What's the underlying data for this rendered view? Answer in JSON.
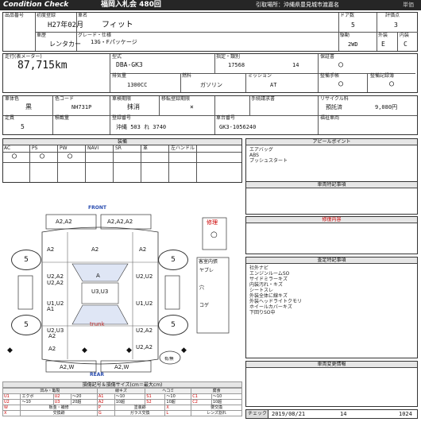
{
  "header": {
    "brand": "Condition Check",
    "auction": "福岡入札会 480回",
    "pickup": "引取場所：沖縄県豊見城市渡嘉名",
    "tail": "単価"
  },
  "top": {
    "lot_label": "出品番号",
    "first_reg_label": "初度登録",
    "first_reg": "H27年02月",
    "name_label": "車名",
    "name": "フィット",
    "doors_label": "ドア数",
    "doors": "5",
    "score_label": "評価点",
    "score": "3",
    "history_label": "車歴",
    "history": "レンタカー",
    "grade_label": "グレード・仕様",
    "grade": "13G・Fパッケージ",
    "drive_label": "駆動",
    "drive": "2WD",
    "ext_label": "外装",
    "ext": "E",
    "int_label": "内装",
    "int": "C"
  },
  "mid": {
    "mileage_label": "走行(表メーター)",
    "mileage": "87,715km",
    "model_label": "型式",
    "model": "DBA-GK3",
    "designation_label": "指定・類別",
    "designation": "17568",
    "category": "14",
    "warranty_label": "保証書",
    "warranty": "○",
    "disp_label": "排気量",
    "disp": "1300CC",
    "fuel_label": "燃料",
    "fuel": "ガソリン",
    "mission_label": "ミッション",
    "mission": "AT",
    "manual_label": "整備手帳",
    "manual": "○",
    "record_label": "整備記録簿",
    "record": "○"
  },
  "body": {
    "color_label": "車体色",
    "color": "黒",
    "code_label": "色コード",
    "code": "NH731P",
    "inspection_label": "車検期限",
    "inspection": "抹消",
    "transfer_label": "移転登録期限",
    "transfer": "×",
    "proxy_label": "手続請求書",
    "proxy": "",
    "recycle_label": "リサイクル料",
    "recycle_tag": "預託済",
    "recycle": "9,080円",
    "capacity_label": "定員",
    "capacity": "5",
    "load_label": "積載量",
    "load": "",
    "plate_label": "登録番号",
    "plate": "沖縄 503 れ 3740",
    "chassis_label": "車台番号",
    "chassis": "GK3-1056240",
    "welfare_label": "福祉車両",
    "welfare": ""
  },
  "equip": {
    "title": "装備",
    "cols": [
      "AC",
      "PS",
      "PW",
      "NAVI",
      "SR",
      "革",
      "左ハンドル"
    ],
    "marks": [
      "○",
      "○",
      "○",
      "",
      "",
      "",
      ""
    ]
  },
  "appeal": {
    "title": "アピールポイント",
    "lines": [
      "エアバッグ",
      "ABS",
      "プッシュスタート"
    ]
  },
  "notes_title": "車両特記事項",
  "repair_title": "修復内容",
  "inspector": {
    "title": "査定特記事項",
    "lines": [
      "社外ナビ",
      "エンジンルームSO",
      "サイドミラーキズ",
      "内装汚れ・キズ",
      "シートスレ",
      "外装全体に線キズ",
      "外装ヘッドライトクモリ",
      "ホイールカバーキズ",
      "下回りSO中"
    ]
  },
  "history_title": "車両変更情報",
  "diagram": {
    "front": "FRONT",
    "rear": "REAR",
    "trunk": "trunk",
    "repair_label": "修理",
    "repair_mark": "○",
    "cabin_label": "客室内張",
    "cabin_items": [
      "ヤブレ",
      "穴",
      "コゲ"
    ],
    "tires": [
      "5",
      "5",
      "5",
      "5"
    ],
    "parts": [
      "A2,A2",
      "A2,A2,A2",
      "A2",
      "A2",
      "U2,A2",
      "A",
      "U2,U2",
      "U2,A2",
      "U3,U3",
      "U1,U2",
      "A1",
      "U1,U2",
      "U2,A2",
      "U2,U3",
      "A2",
      "U2,A2",
      "A2",
      "A2",
      "A2,W",
      "A2,W"
    ],
    "check_label": "有/無",
    "check_mark": "○"
  },
  "legend": {
    "title": "損傷記号＆損傷サイズ(cm＝最大cm)",
    "head": [
      "凹み・亀裂",
      "線キズ",
      "ヘコミ",
      "腐食"
    ],
    "r1": [
      "U1",
      "エクボ",
      "U2",
      "～20",
      "A1",
      "～10",
      "S1",
      "～10",
      "C1",
      "～10"
    ],
    "r2": [
      "U2",
      "～10",
      "U3",
      "20超",
      "A2",
      "10超",
      "S2",
      "10超",
      "C2",
      "10超"
    ],
    "r3": [
      "W",
      "板金・補修",
      "P",
      "塗装跡",
      "X",
      "要交換"
    ],
    "r4": [
      "X",
      "交換跡",
      "G",
      "ガラス交換",
      "L",
      "レンズ割れ"
    ]
  },
  "footer": {
    "check_label": "チェック",
    "date": "2019/08/21",
    "num": "14",
    "code": "1024"
  },
  "colors": {
    "header_bg": "#262626",
    "front": "#2a4db0",
    "rear": "#2a4db0",
    "trunk": "#c03030",
    "panel": "#dfe6f5"
  }
}
